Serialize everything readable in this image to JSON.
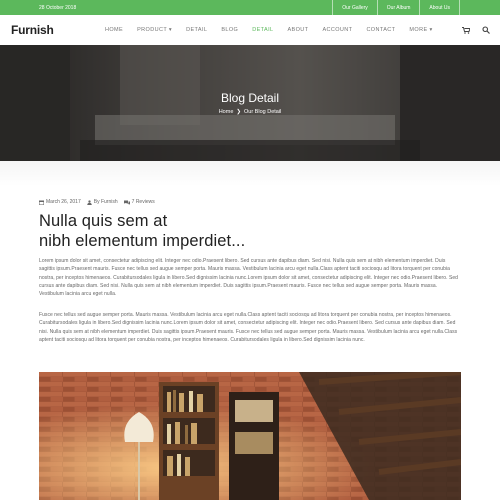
{
  "topbar": {
    "date": "28 October 2018",
    "links": [
      "Our Gallery",
      "Our Album",
      "About Us"
    ]
  },
  "nav": {
    "logo": "Furnish",
    "items": [
      "HOME",
      "PRODUCT ▾",
      "DETAIL",
      "BLOG",
      "DETAIL",
      "ABOUT",
      "ACCOUNT",
      "CONTACT",
      "MORE ▾"
    ],
    "active_index": 4,
    "icons": [
      "cart-icon",
      "search-icon"
    ]
  },
  "hero": {
    "title": "Blog Detail",
    "breadcrumb_home": "Home",
    "breadcrumb_sep": "❯",
    "breadcrumb_current": "Our Blog Detail"
  },
  "post": {
    "date": "March 26, 2017",
    "author": "By Furnish",
    "reviews": "7 Reviews",
    "title_line1": "Nulla quis sem at",
    "title_line2": "nibh elementum imperdiet...",
    "paragraph1": "Lorem ipsum dolor sit amet, consectetur adipiscing elit. Integer nec odio.Praesent libero. Sed cursus ante dapibus diam. Sed nisi. Nulla quis sem at nibh elementum imperdiet. Duis sagittis ipsum.Praesent mauris. Fusce nec tellus sed augue semper porta. Mauris massa. Vestibulum lacinia arcu eget nulla.Class aptent taciti sociosqu ad litora torquent per conubia nostra, per inceptos himenaeos. Curabitursodales ligula in libero.Sed dignissim lacinia nunc.Lorem ipsum dolor sit amet, consectetur adipiscing elit. Integer nec odio.Praesent libero. Sed cursus ante dapibus diam. Sed nisi. Nulla quis sem at nibh elementum imperdiet. Duis sagittis ipsum.Praesent mauris. Fusce nec tellus sed augue semper porta. Mauris massa. Vestibulum lacinia arcu eget nulla.",
    "paragraph2": "Fusce nec tellus sed augue semper porta. Mauris massa. Vestibulum lacinia arcu eget nulla.Class aptent taciti sociosqu ad litora torquent per conubia nostra, per inceptos himenaeos. Curabitursodales ligula in libero.Sed dignissim lacinia nunc.Lorem ipsum dolor sit amet, consectetur adipiscing elit. Integer nec odio.Praesent libero. Sed cursus ante dapibus diam. Sed nisi. Nulla quis sem at nibh elementum imperdiet. Duis sagittis ipsum.Praesent mauris. Fusce nec tellus sed augue semper porta. Mauris massa. Vestibulum lacinia arcu eget nulla.Class aptent taciti sociosqu ad litora torquent per conubia nostra, per inceptos himenaeos. Curabitursodales ligula in libero.Sed dignissim lacinia nunc."
  },
  "colors": {
    "accent": "#5cb85c",
    "title": "#222222",
    "text": "#666666"
  }
}
